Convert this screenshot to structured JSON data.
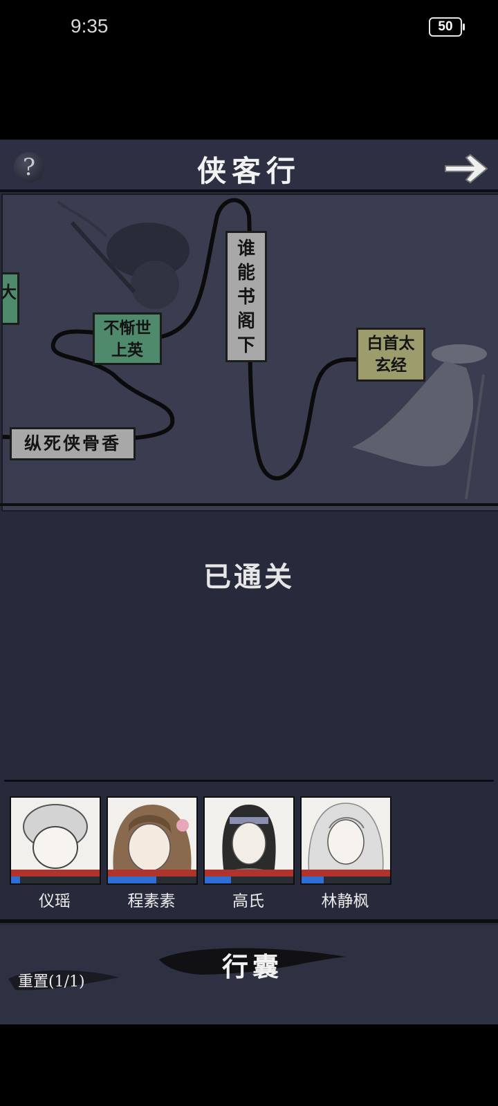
{
  "status_bar": {
    "time": "9:35",
    "battery": "50"
  },
  "header": {
    "title": "侠客行",
    "help_icon": "question-mark-icon",
    "next_icon": "arrow-right-icon"
  },
  "map": {
    "nodes": [
      {
        "text": "大",
        "color": "green"
      },
      {
        "text_line1": "不惭世",
        "text_line2": "上英",
        "color": "green"
      },
      {
        "text": "纵死侠骨香",
        "color": "grey"
      },
      {
        "text": [
          "谁",
          "能",
          "书",
          "阁",
          "下"
        ],
        "color": "grey"
      },
      {
        "text_line1": "白首太",
        "text_line2": "玄经",
        "color": "khaki"
      }
    ]
  },
  "status_text": "已通关",
  "party": [
    {
      "name": "仪瑶",
      "mp_fill": 0.1
    },
    {
      "name": "程素素",
      "mp_fill": 0.55
    },
    {
      "name": "高氏",
      "mp_fill": 0.3
    },
    {
      "name": "林静枫",
      "mp_fill": 0.25
    }
  ],
  "bottom": {
    "bag_label": "行囊",
    "reset_label": "重置(1/1)"
  },
  "colors": {
    "background": "#272a3a",
    "hp": "#b0342e",
    "mp": "#2e6fd6"
  }
}
